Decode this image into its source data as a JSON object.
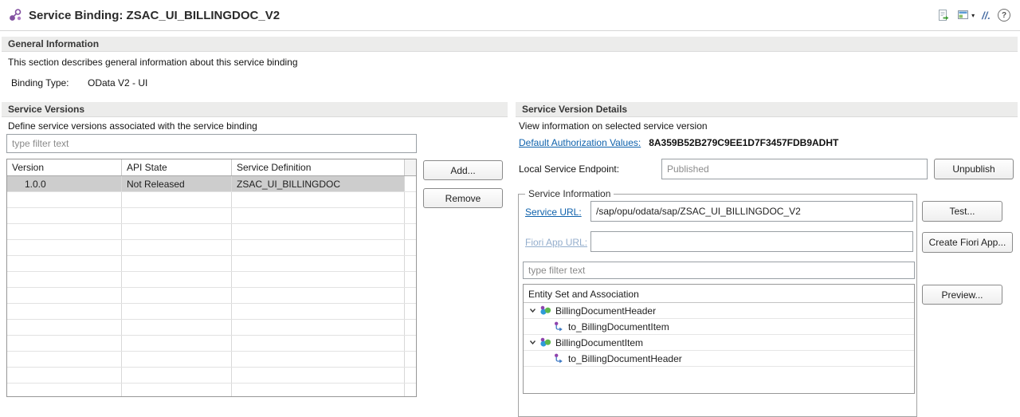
{
  "titlebar": {
    "title": "Service Binding: ZSAC_UI_BILLINGDOC_V2"
  },
  "icons": {
    "dropdown": "▾",
    "slashes": "//.",
    "help": "?"
  },
  "general": {
    "header": "General Information",
    "description": "This section describes general information about this service binding",
    "binding_type_label": "Binding Type:",
    "binding_type_value": "OData V2 - UI"
  },
  "versions": {
    "header": "Service Versions",
    "description": "Define service versions associated with the service binding",
    "filter_placeholder": "type filter text",
    "columns": [
      "Version",
      "API State",
      "Service Definition"
    ],
    "rows": [
      {
        "version": "1.0.0",
        "api_state": "Not Released",
        "service_definition": "ZSAC_UI_BILLINGDOC"
      }
    ],
    "add_button": "Add...",
    "remove_button": "Remove"
  },
  "details": {
    "header": "Service Version Details",
    "description": "View information on selected service version",
    "auth_link": "Default Authorization Values:",
    "auth_value": "8A359B52B279C9EE1D7F3457FDB9ADHT",
    "endpoint_label": "Local Service Endpoint:",
    "endpoint_value": "Published",
    "unpublish_button": "Unpublish",
    "group_title": "Service Information",
    "service_url_label": "Service URL:",
    "service_url_value": "/sap/opu/odata/sap/ZSAC_UI_BILLINGDOC_V2",
    "test_button": "Test...",
    "fiori_label": "Fiori App URL:",
    "fiori_value": "",
    "create_fiori_button": "Create Fiori App...",
    "filter_placeholder": "type filter text",
    "tree_header": "Entity Set and Association",
    "tree": [
      {
        "label": "BillingDocumentHeader",
        "children": [
          {
            "label": "to_BillingDocumentItem"
          }
        ]
      },
      {
        "label": "BillingDocumentItem",
        "children": [
          {
            "label": "to_BillingDocumentHeader"
          }
        ]
      }
    ],
    "preview_button": "Preview..."
  }
}
